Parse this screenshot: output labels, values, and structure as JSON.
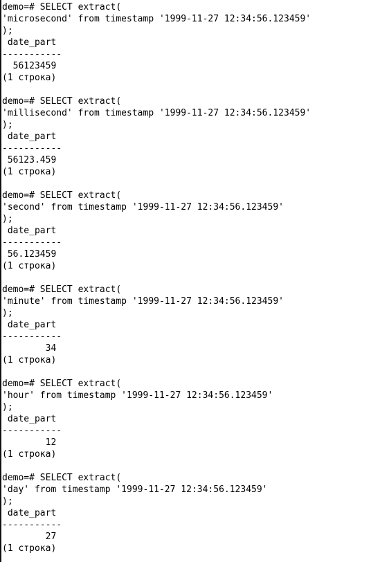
{
  "terminal": {
    "lines": [
      "demo=# SELECT extract(",
      "'microsecond' from timestamp '1999-11-27 12:34:56.123459'",
      ");",
      " date_part",
      "-----------",
      "  56123459",
      "(1 строка)",
      "",
      "demo=# SELECT extract(",
      "'millisecond' from timestamp '1999-11-27 12:34:56.123459'",
      ");",
      " date_part",
      "-----------",
      " 56123.459",
      "(1 строка)",
      "",
      "demo=# SELECT extract(",
      "'second' from timestamp '1999-11-27 12:34:56.123459'",
      ");",
      " date_part",
      "-----------",
      " 56.123459",
      "(1 строка)",
      "",
      "demo=# SELECT extract(",
      "'minute' from timestamp '1999-11-27 12:34:56.123459'",
      ");",
      " date_part",
      "-----------",
      "        34",
      "(1 строка)",
      "",
      "demo=# SELECT extract(",
      "'hour' from timestamp '1999-11-27 12:34:56.123459'",
      ");",
      " date_part",
      "-----------",
      "        12",
      "(1 строка)",
      "",
      "demo=# SELECT extract(",
      "'day' from timestamp '1999-11-27 12:34:56.123459'",
      ");",
      " date_part",
      "-----------",
      "        27",
      "(1 строка)"
    ]
  }
}
